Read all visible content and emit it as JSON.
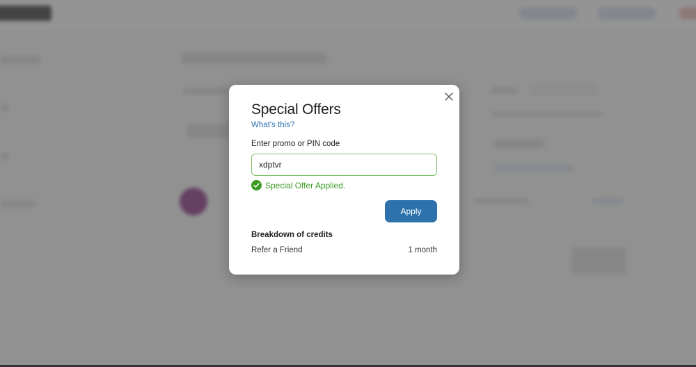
{
  "modal": {
    "title": "Special Offers",
    "help_link": "What's this?",
    "promo_label": "Enter promo or PIN code",
    "promo_value": "xdptvr",
    "status_text": "Special Offer Applied.",
    "apply_label": "Apply",
    "breakdown_title": "Breakdown of credits",
    "credits": [
      {
        "name": "Refer a Friend",
        "value": "1 month"
      }
    ]
  },
  "colors": {
    "accent": "#2d72ad",
    "success": "#3a9a22",
    "input_border_success": "#7fbf6a"
  },
  "icons": {
    "close": "close-icon",
    "success": "check-circle-icon"
  }
}
